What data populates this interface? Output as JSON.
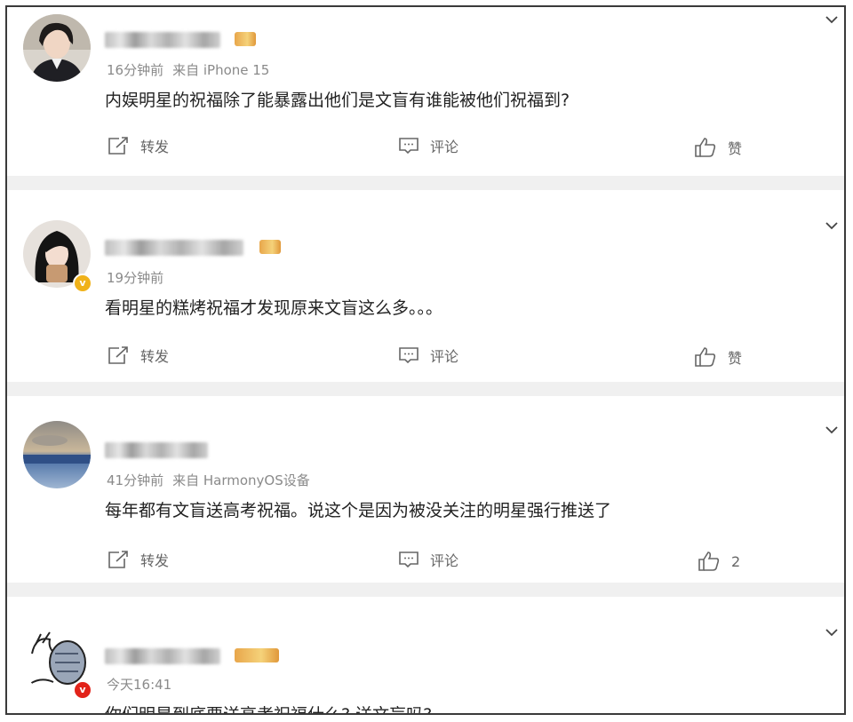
{
  "actions": {
    "repost": "转发",
    "comment": "评论",
    "like": "赞"
  },
  "posts": [
    {
      "time": "16分钟前",
      "source": "来自 iPhone 15",
      "text": "内娱明星的祝福除了能暴露出他们是文盲有谁能被他们祝福到?",
      "like_count": "",
      "has_rank_badge": true
    },
    {
      "time": "19分钟前",
      "source": "",
      "text": "看明星的糕烤祝福才发现原来文盲这么多。。。",
      "like_count": "",
      "has_rank_badge": true,
      "verified": "gold"
    },
    {
      "time": "41分钟前",
      "source": "来自 HarmonyOS设备",
      "text": "每年都有文盲送高考祝福。说这个是因为被没关注的明星强行推送了",
      "like_count": "2",
      "has_rank_badge": false
    },
    {
      "time": "今天16:41",
      "source": "",
      "text": "你们明星到底要送高考祝福什么? 送文盲吗?",
      "like_count": "",
      "has_rank_badge": true,
      "verified": "red"
    }
  ],
  "colors": {
    "divider": "#f0f0f0",
    "meta_text": "#8a8a8a",
    "body_text": "#222222",
    "gold_badge": "#f0b21a",
    "red_badge": "#e2231a"
  },
  "icons": {
    "chevron": "chevron-down-icon",
    "repost": "repost-icon",
    "comment": "comment-icon",
    "like": "thumbs-up-icon"
  }
}
